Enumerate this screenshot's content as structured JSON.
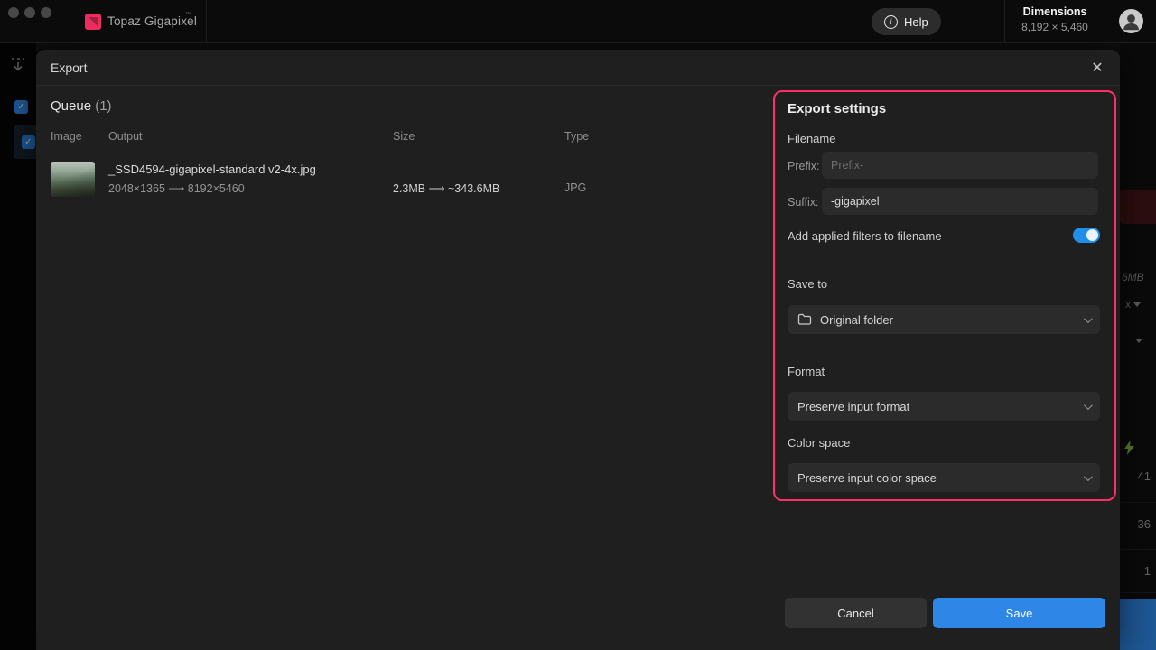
{
  "titlebar": {
    "app_name": "Topaz Gigapixel",
    "trademark": "™",
    "help_label": "Help",
    "dimensions_label": "Dimensions",
    "dimensions_value": "8,192 × 5,460"
  },
  "modal": {
    "title": "Export",
    "queue": {
      "heading": "Queue",
      "count": "(1)",
      "columns": [
        "Image",
        "Output",
        "Size",
        "Type"
      ],
      "row": {
        "filename": "_SSD4594-gigapixel-standard v2-4x.jpg",
        "resolution": "2048×1365 ⟶ 8192×5460",
        "size": "2.3MB ⟶ ~343.6MB",
        "type": "JPG"
      }
    },
    "settings": {
      "heading": "Export settings",
      "filename_label": "Filename",
      "prefix_label": "Prefix:",
      "prefix_placeholder": "Prefix-",
      "suffix_label": "Suffix:",
      "suffix_value": "-gigapixel",
      "filters_toggle_label": "Add applied filters to filename",
      "toggle_state": "on",
      "save_to_label": "Save to",
      "save_to_value": "Original folder",
      "format_label": "Format",
      "format_value": "Preserve input format",
      "color_space_label": "Color space",
      "color_space_value": "Preserve input color space"
    },
    "actions": {
      "cancel_label": "Cancel",
      "save_label": "Save"
    }
  },
  "side_panel": {
    "size_text": "6MB",
    "px_text": "x",
    "values": [
      "41",
      "36",
      "1"
    ]
  },
  "icons": {
    "close": "✕",
    "check": "✓"
  },
  "colors": {
    "accent_pink": "#ff2e6d",
    "accent_blue": "#2e87e6",
    "toggle_on": "#1f8fe8"
  }
}
